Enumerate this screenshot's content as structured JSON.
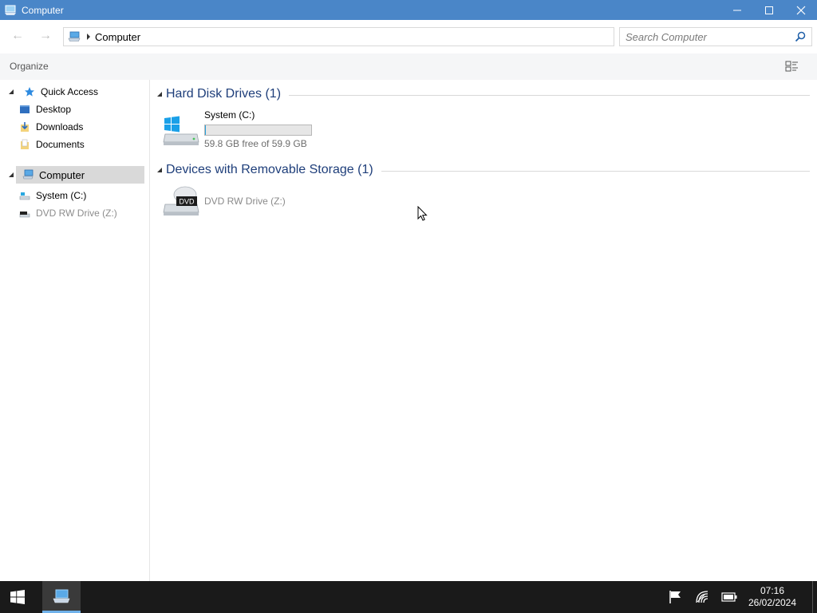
{
  "window": {
    "title": "Computer",
    "controls": {
      "minimize": "—",
      "maximize": "☐",
      "close": "✕"
    }
  },
  "address": {
    "back": "←",
    "forward": "→",
    "path": "Computer",
    "search_placeholder": "Search Computer"
  },
  "toolbar": {
    "organize_label": "Organize"
  },
  "sidebar": {
    "quick_access": "Quick Access",
    "desktop": "Desktop",
    "downloads": "Downloads",
    "documents": "Documents",
    "computer": "Computer",
    "system_c": "System (C:)",
    "dvd": "DVD RW Drive (Z:)"
  },
  "groups": {
    "hdd_title": "Hard Disk Drives (1)",
    "removable_title": "Devices with Removable Storage (1)"
  },
  "drives": {
    "system": {
      "name": "System (C:)",
      "free_text": "59.8 GB free of 59.9 GB",
      "used_fraction": 0.0017
    },
    "dvd": {
      "name": "DVD RW Drive (Z:)",
      "badge": "DVD"
    }
  },
  "taskbar": {
    "time": "07:16",
    "date": "26/02/2024"
  },
  "colors": {
    "titlebar": "#4a86c8",
    "group_header": "#1e3e7a",
    "taskbar": "#1a1a1a"
  }
}
